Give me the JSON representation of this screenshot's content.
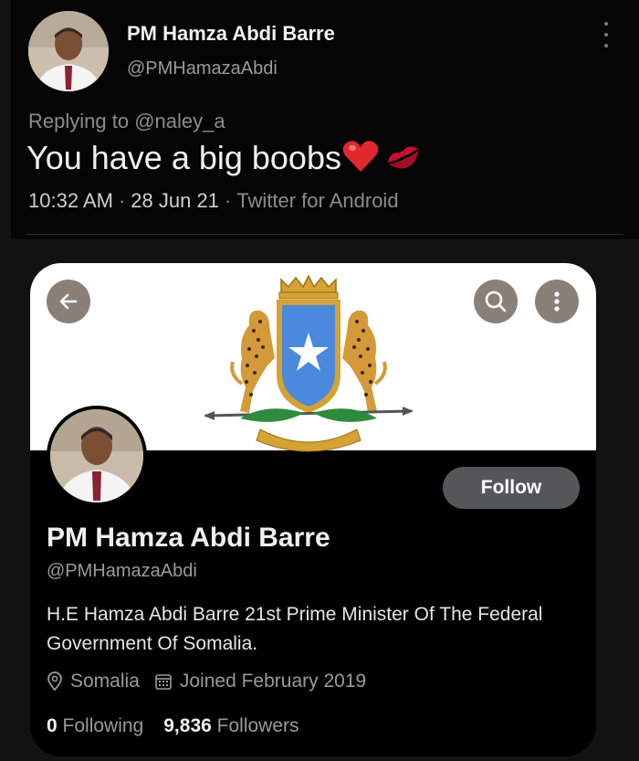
{
  "tweet": {
    "author_name": "PM Hamza Abdi Barre",
    "author_handle": "@PMHamazaAbdi",
    "replying_prefix": "Replying to",
    "replying_to": "@naley_a",
    "text": "You have a big boobs",
    "emojis": [
      "red-heart",
      "kiss-mark"
    ],
    "time": "10:32 AM",
    "date": "28 Jun 21",
    "client": "Twitter for Android",
    "separator": "·"
  },
  "profile": {
    "name": "PM Hamza Abdi Barre",
    "handle": "@PMHamazaAbdi",
    "follow_label": "Follow",
    "bio": "H.E Hamza Abdi Barre 21st Prime Minister Of The Federal Government Of Somalia.",
    "location": "Somalia",
    "joined": "Joined February 2019",
    "following_count": "0",
    "following_label": "Following",
    "followers_count": "9,836",
    "followers_label": "Followers"
  },
  "icons": {
    "back": "arrow-left-icon",
    "search": "search-icon",
    "more": "more-vertical-icon",
    "location": "location-pin-icon",
    "calendar": "calendar-icon"
  },
  "colors": {
    "background": "#121212",
    "card": "#000000",
    "banner": "#ffffff",
    "follow_button": "#54575a",
    "flag_blue": "#4a89dc",
    "gold": "#d4a334"
  }
}
